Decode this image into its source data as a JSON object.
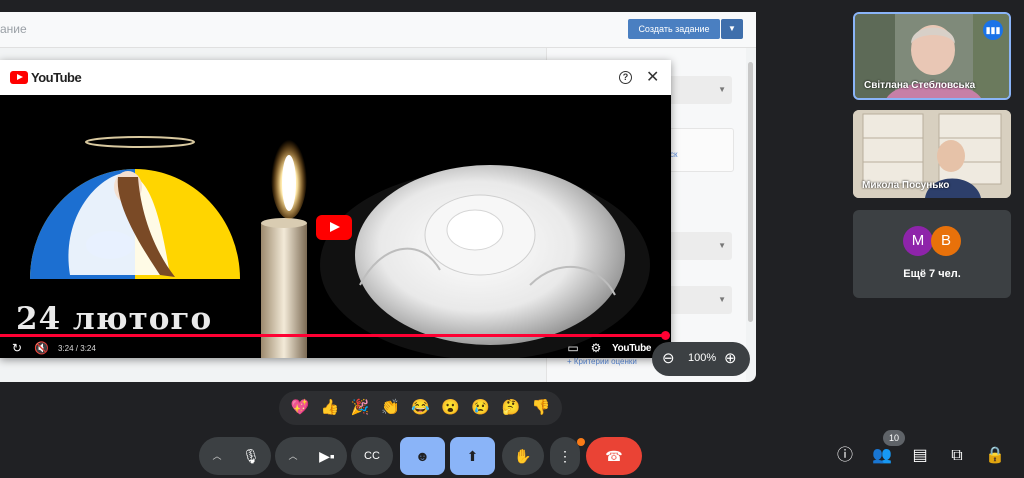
{
  "shared_screen": {
    "page_title": "ание",
    "create_button": "Создать задание",
    "criteria_link": "+ Критерии оценки",
    "box_link": "ск"
  },
  "youtube": {
    "logo_text": "YouTube",
    "video_title": "24 лютого",
    "time": "3:24 / 3:24",
    "progress": 1.0,
    "mini_logo": "YouTube",
    "icons": [
      "help-icon",
      "close-icon",
      "replay-icon",
      "mute-icon",
      "subtitles-icon",
      "settings-icon",
      "fullscreen-icon"
    ]
  },
  "zoom": {
    "value": "100%"
  },
  "participants": [
    {
      "name": "Світлана Стебловська",
      "speaking": true
    },
    {
      "name": "Микола Посунько"
    }
  ],
  "more": {
    "avatars": [
      {
        "letter": "M",
        "color": "#8e24aa"
      },
      {
        "letter": "B",
        "color": "#e8710a"
      }
    ],
    "label": "Ещё 7 чел."
  },
  "reactions": [
    "💖",
    "👍",
    "🎉",
    "👏",
    "😂",
    "😮",
    "😢",
    "🤔",
    "👎"
  ],
  "controls": {
    "participants_count": "10"
  },
  "colors": {
    "accent_blue": "#8ab4f8",
    "end_call_red": "#ea4335",
    "background": "#202124"
  }
}
